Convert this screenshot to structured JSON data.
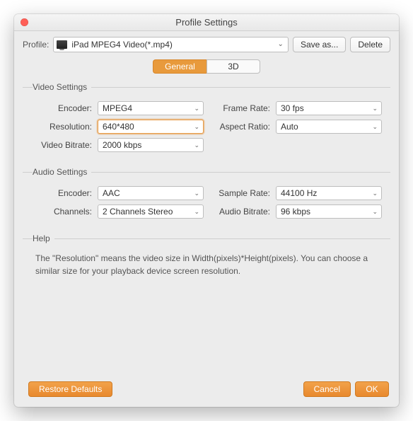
{
  "window": {
    "title": "Profile Settings"
  },
  "profile_row": {
    "label": "Profile:",
    "selected": "iPad MPEG4 Video(*.mp4)",
    "save_as": "Save as...",
    "delete": "Delete"
  },
  "tabs": {
    "general": "General",
    "threeD": "3D"
  },
  "video": {
    "legend": "Video Settings",
    "encoder_label": "Encoder:",
    "encoder": "MPEG4",
    "resolution_label": "Resolution:",
    "resolution": "640*480",
    "bitrate_label": "Video Bitrate:",
    "bitrate": "2000 kbps",
    "framerate_label": "Frame Rate:",
    "framerate": "30 fps",
    "aspect_label": "Aspect Ratio:",
    "aspect": "Auto"
  },
  "audio": {
    "legend": "Audio Settings",
    "encoder_label": "Encoder:",
    "encoder": "AAC",
    "channels_label": "Channels:",
    "channels": "2 Channels Stereo",
    "samplerate_label": "Sample Rate:",
    "samplerate": "44100 Hz",
    "abitrate_label": "Audio Bitrate:",
    "abitrate": "96 kbps"
  },
  "help": {
    "legend": "Help",
    "text": "The \"Resolution\" means the video size in Width(pixels)*Height(pixels).  You can choose a similar size for your playback device screen resolution."
  },
  "footer": {
    "restore": "Restore Defaults",
    "cancel": "Cancel",
    "ok": "OK"
  },
  "colors": {
    "accent": "#e8892e"
  }
}
